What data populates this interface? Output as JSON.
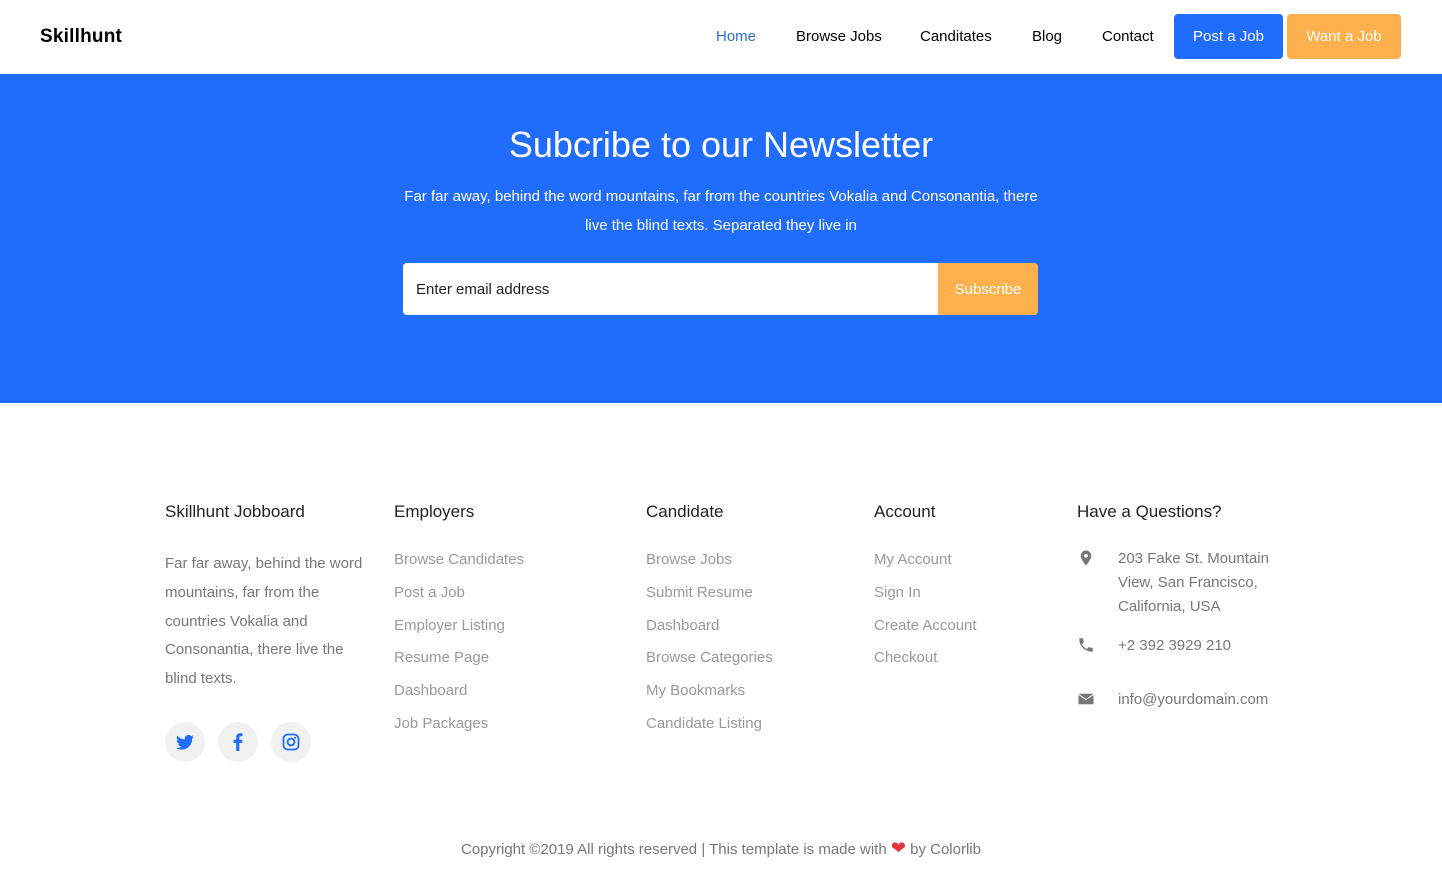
{
  "nav": {
    "brand": "Skillhunt",
    "links": [
      "Home",
      "Browse Jobs",
      "Canditates",
      "Blog",
      "Contact"
    ],
    "post_job": "Post a Job",
    "want_job": "Want a Job"
  },
  "newsletter": {
    "title": "Subcribe to our Newsletter",
    "description": "Far far away, behind the word mountains, far from the countries Vokalia and Consonantia, there live the blind texts. Separated they live in",
    "email_placeholder": "Enter email address",
    "subscribe": "Subscribe"
  },
  "footer": {
    "about": {
      "heading": "Skillhunt Jobboard",
      "text": "Far far away, behind the word mountains, far from the countries Vokalia and Consonantia, there live the blind texts."
    },
    "employers": {
      "heading": "Employers",
      "items": [
        "Browse Candidates",
        "Post a Job",
        "Employer Listing",
        "Resume Page",
        "Dashboard",
        "Job Packages"
      ]
    },
    "candidate": {
      "heading": "Candidate",
      "items": [
        "Browse Jobs",
        "Submit Resume",
        "Dashboard",
        "Browse Categories",
        "My Bookmarks",
        "Candidate Listing"
      ]
    },
    "account": {
      "heading": "Account",
      "items": [
        "My Account",
        "Sign In",
        "Create Account",
        "Checkout"
      ]
    },
    "contact": {
      "heading": "Have a Questions?",
      "address": "203 Fake St. Mountain View, San Francisco, California, USA",
      "phone": "+2 392 3929 210",
      "email": "info@yourdomain.com"
    },
    "social": [
      "twitter-icon",
      "facebook-icon",
      "instagram-icon"
    ],
    "copyright_before": "Copyright ©2019 All rights reserved | This template is made with",
    "copyright_after": "by Colorlib"
  },
  "colors": {
    "primary": "#206dfd",
    "accent": "#fdb04b",
    "active_link": "#2f6fd1",
    "heart": "#e8323a"
  }
}
